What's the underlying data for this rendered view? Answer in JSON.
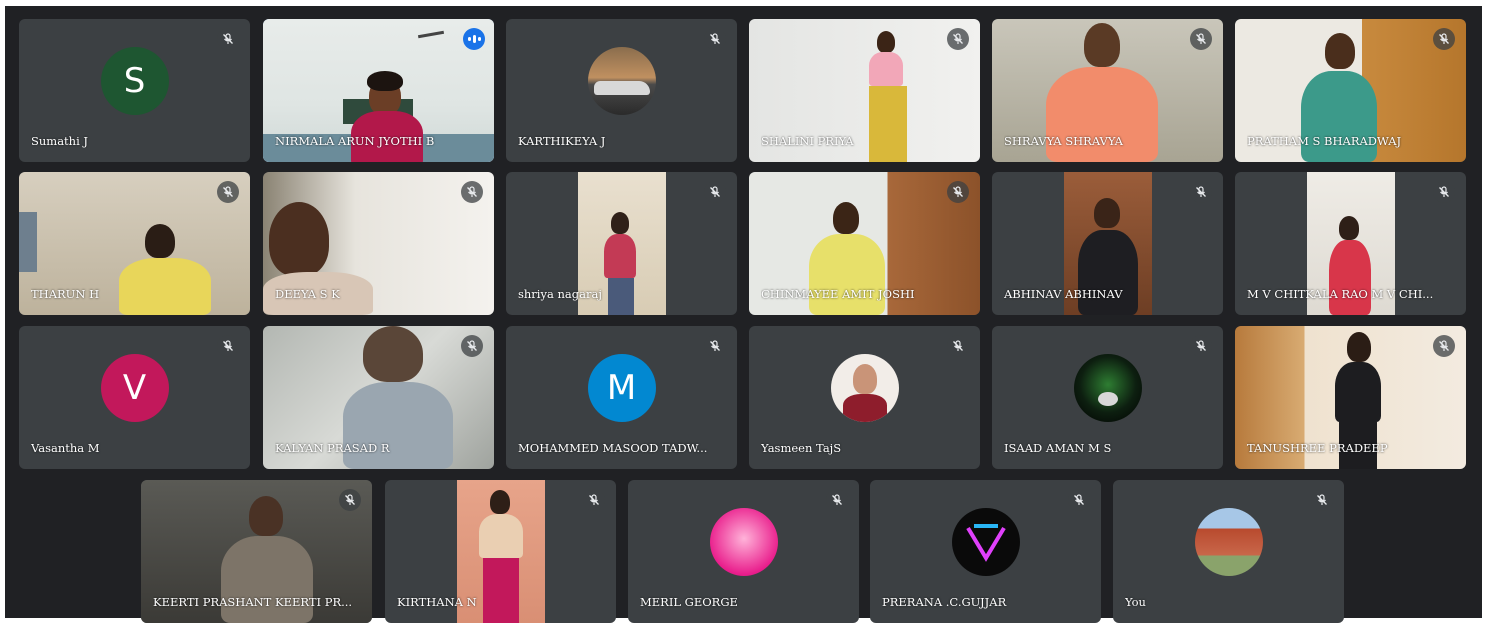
{
  "meeting": {
    "app": "Google Meet",
    "layout": "tiled grid",
    "colors": {
      "background": "#202124",
      "tile": "#3c4043",
      "active_outline": "#8ab4f8",
      "speaking_badge": "#1a73e8"
    },
    "participants": [
      {
        "name": "Sumathi J",
        "type": "initial",
        "initial": "S",
        "color": "#1e5631",
        "muted": true
      },
      {
        "name": "NIRMALA ARUN JYOTHI B",
        "type": "video",
        "speaking": true,
        "muted": false
      },
      {
        "name": "KARTHIKEYA J",
        "type": "photo",
        "muted": true
      },
      {
        "name": "SHALINI PRIYA",
        "type": "video",
        "muted": true
      },
      {
        "name": "SHRAVYA SHRAVYA",
        "type": "video",
        "muted": true
      },
      {
        "name": "PRATHAM S BHARADWAJ",
        "type": "video",
        "muted": true
      },
      {
        "name": "THARUN H",
        "type": "video",
        "muted": true
      },
      {
        "name": "DEEYA S K",
        "type": "video",
        "muted": true
      },
      {
        "name": "shriya nagaraj",
        "type": "video",
        "muted": true
      },
      {
        "name": "CHINMAYEE AMIT JOSHI",
        "type": "video",
        "muted": true
      },
      {
        "name": "ABHINAV ABHINAV",
        "type": "video",
        "muted": true
      },
      {
        "name": "M V CHITKALA RAO M V CHI...",
        "type": "video",
        "muted": true
      },
      {
        "name": "Vasantha M",
        "type": "initial",
        "initial": "V",
        "color": "#c2185b",
        "muted": true
      },
      {
        "name": "KALYAN PRASAD R",
        "type": "video",
        "muted": true
      },
      {
        "name": "MOHAMMED MASOOD TADW...",
        "type": "initial",
        "initial": "M",
        "color": "#0288d1",
        "muted": true
      },
      {
        "name": "Yasmeen TajS",
        "type": "photo",
        "muted": true
      },
      {
        "name": "ISAAD AMAN M S",
        "type": "photo",
        "muted": true
      },
      {
        "name": "TANUSHREE PRADEEP",
        "type": "video",
        "muted": true
      },
      {
        "name": "KEERTI PRASHANT KEERTI PR...",
        "type": "video",
        "muted": true
      },
      {
        "name": "KIRTHANA N",
        "type": "video",
        "muted": true
      },
      {
        "name": "MERIL GEORGE",
        "type": "photo",
        "muted": true
      },
      {
        "name": "PRERANA .C.GUJJAR",
        "type": "photo",
        "muted": true
      },
      {
        "name": "You",
        "type": "photo",
        "muted": true
      }
    ],
    "icons": {
      "muted": "mic-off-icon",
      "speaking": "audio-level-icon"
    }
  }
}
